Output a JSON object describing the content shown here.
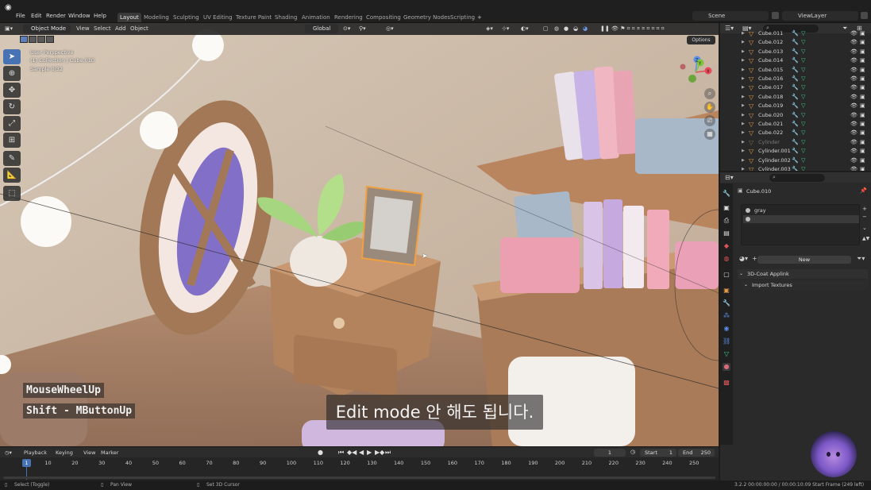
{
  "topbar": {
    "menus": [
      "File",
      "Edit",
      "Render",
      "Window",
      "Help"
    ],
    "workspaces": [
      "Layout",
      "Modeling",
      "Sculpting",
      "UV Editing",
      "Texture Paint",
      "Shading",
      "Animation",
      "Rendering",
      "Compositing",
      "Geometry Nodes",
      "Scripting"
    ],
    "add_tab": "+",
    "scene": "Scene",
    "view_layer": "ViewLayer"
  },
  "viewport": {
    "mode": "Object Mode",
    "menus": [
      "View",
      "Select",
      "Add",
      "Object"
    ],
    "transform_orientation": "Global",
    "options_label": "Options",
    "overlay": {
      "perspective": "User Perspective",
      "collection": "(1) Collection | Cube.010",
      "sample": "Sample 0/32"
    },
    "gizmo_axes": [
      "Z",
      "Y",
      "X"
    ]
  },
  "captions": {
    "key1": "MouseWheelUp",
    "key2": "Shift - MButtonUp",
    "subtitle": "Edit mode 안 해도 됩니다."
  },
  "outliner": {
    "rows": [
      {
        "name": "Cube.011",
        "dim": false
      },
      {
        "name": "Cube.012",
        "dim": false
      },
      {
        "name": "Cube.013",
        "dim": false
      },
      {
        "name": "Cube.014",
        "dim": false
      },
      {
        "name": "Cube.015",
        "dim": false
      },
      {
        "name": "Cube.016",
        "dim": false
      },
      {
        "name": "Cube.017",
        "dim": false
      },
      {
        "name": "Cube.018",
        "dim": false
      },
      {
        "name": "Cube.019",
        "dim": false
      },
      {
        "name": "Cube.020",
        "dim": false
      },
      {
        "name": "Cube.021",
        "dim": false
      },
      {
        "name": "Cube.022",
        "dim": false
      },
      {
        "name": "Cylinder",
        "dim": true
      },
      {
        "name": "Cylinder.001",
        "dim": false
      },
      {
        "name": "Cylinder.002",
        "dim": false
      },
      {
        "name": "Cylinder.003",
        "dim": false
      }
    ]
  },
  "properties": {
    "object_name": "Cube.010",
    "material_slots": [
      "gray",
      ""
    ],
    "new_button": "New",
    "panels": [
      "3D-Coat Applink",
      "Import Textures"
    ]
  },
  "timeline": {
    "menus": [
      "Playback",
      "Keying",
      "View",
      "Marker"
    ],
    "current_frame": "1",
    "start_label": "Start",
    "start_value": "1",
    "end_label": "End",
    "end_value": "250",
    "ticks": [
      "1",
      "10",
      "20",
      "30",
      "40",
      "50",
      "60",
      "70",
      "80",
      "90",
      "100",
      "110",
      "120",
      "130",
      "140",
      "150",
      "160",
      "170",
      "180",
      "190",
      "200",
      "210",
      "220",
      "230",
      "240",
      "250"
    ],
    "cursor_label": "1"
  },
  "statusbar": {
    "left": "Select (Toggle)",
    "middle": "Pan View",
    "right_hint": "Set 3D Cursor",
    "version_info": "3.2.2  00:00:00:00 / 00:00:10:09  Start Frame (249 left)"
  },
  "colors": {
    "accent": "#4772b3",
    "object_icon": "#e59a4a",
    "mesh_icon": "#3fd28c",
    "selection_outline": "#f0a040"
  }
}
